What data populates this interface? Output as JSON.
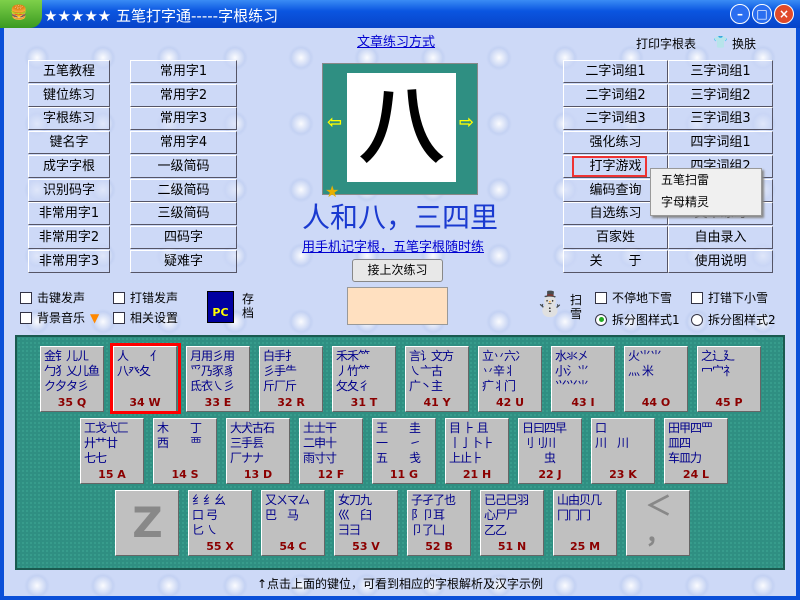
{
  "window": {
    "title": "★★★★★ 五笔打字通-----字根练习",
    "min": "–",
    "max": "□",
    "close": "×"
  },
  "top_link": "文章练习方式",
  "print_label": "打印字根表",
  "skin_label": "换肤",
  "left_buttons": [
    [
      "五笔教程",
      "常用字1"
    ],
    [
      "键位练习",
      "常用字2"
    ],
    [
      "字根练习",
      "常用字3"
    ],
    [
      "键名字",
      "常用字4"
    ],
    [
      "成字字根",
      "一级简码"
    ],
    [
      "识别码字",
      "二级简码"
    ],
    [
      "非常用字1",
      "三级简码"
    ],
    [
      "非常用字2",
      "四码字"
    ],
    [
      "非常用字3",
      "疑难字"
    ]
  ],
  "right_buttons": [
    [
      "二字词组1",
      "三字词组1"
    ],
    [
      "二字词组2",
      "三字词组2"
    ],
    [
      "二字词组3",
      "三字词组3"
    ],
    [
      "强化练习",
      "四字词组1"
    ],
    [
      "打字游戏",
      "四字词组2"
    ],
    [
      "编码查询",
      ""
    ],
    [
      "自选练习",
      "文章练习"
    ],
    [
      "百家姓",
      "自由录入"
    ],
    [
      "关　　于",
      "使用说明"
    ]
  ],
  "popup_menu": [
    "五笔扫雷",
    "字母精灵"
  ],
  "display": {
    "char": "八",
    "mnemonic": "人和八，三四里",
    "app_link": "用手机记字根，五笔字根随时练",
    "resume_button": "接上次练习"
  },
  "options": {
    "key_sound": "击键发声",
    "error_sound": "打错发声",
    "bg_music": "背景音乐",
    "settings": "相关设置",
    "save": "存档",
    "save_icon_text": "PC",
    "sweep_snow": "扫雪",
    "snow_nonstop": "不停地下雪",
    "snow_on_error": "打错下小雪",
    "style1": "拆分图样式1",
    "style2": "拆分图样式2"
  },
  "keys": [
    [
      {
        "roots": [
          "金钅儿ㄦ",
          "勹犭乂儿鱼",
          "ク夕タ彡"
        ],
        "code": "35 Q"
      },
      {
        "roots": [
          "人　　亻",
          "",
          "八癶夂"
        ],
        "code": "34 W"
      },
      {
        "roots": [
          "月用彡用",
          "爫乃豕豸",
          "氐衣㇏彡"
        ],
        "code": "33 E"
      },
      {
        "roots": [
          "白手扌",
          "彡手⺧",
          "斤厂斤"
        ],
        "code": "32 R"
      },
      {
        "roots": [
          "禾禾⺮",
          "丿竹⺮",
          "攵夂彳"
        ],
        "code": "31 T"
      },
      {
        "roots": [
          "言讠文方",
          "㇏亠古",
          "广丶主"
        ],
        "code": "41 Y"
      },
      {
        "roots": [
          "立丷六冫",
          "丷辛丬",
          "疒丬门"
        ],
        "code": "42 U"
      },
      {
        "roots": [
          "水氺㐅",
          "小氵⺌",
          "⺍⺍⺌"
        ],
        "code": "43 I"
      },
      {
        "roots": [
          "火⺌⺌",
          "",
          "灬 米"
        ],
        "code": "44 O"
      },
      {
        "roots": [
          "之辶廴",
          "",
          "冖宀礻"
        ],
        "code": "45 P"
      }
    ],
    [
      {
        "roots": [
          "工戈弋匚",
          "廾艹廿",
          "七七"
        ],
        "code": "15 A"
      },
      {
        "roots": [
          "木　　丁",
          "",
          "西　　覀"
        ],
        "code": "14 S"
      },
      {
        "roots": [
          "大犬古石",
          "三手镸",
          "厂ナナ"
        ],
        "code": "13 D"
      },
      {
        "roots": [
          "土士干",
          "二申十",
          "雨寸寸"
        ],
        "code": "12 F"
      },
      {
        "roots": [
          "王　　圭",
          "一　　㇀",
          "五　　戋"
        ],
        "code": "11 G"
      },
      {
        "roots": [
          "目 ⺊ 且",
          "丨亅卜⺊",
          "上止⺊"
        ],
        "code": "21 H"
      },
      {
        "roots": [
          "日曰四早",
          "刂刂川",
          "　　虫"
        ],
        "code": "22 J"
      },
      {
        "roots": [
          "口",
          "",
          "川　川"
        ],
        "code": "23 K"
      },
      {
        "roots": [
          "田甲四罒",
          "皿四",
          "车皿力"
        ],
        "code": "24 L"
      }
    ],
    [
      {
        "roots": [
          "Z"
        ],
        "code": ""
      },
      {
        "roots": [
          "纟纟幺",
          "口 弓",
          "匕 ㇏"
        ],
        "code": "55 X"
      },
      {
        "roots": [
          "又ㄨマ厶",
          "",
          "巴　马"
        ],
        "code": "54 C"
      },
      {
        "roots": [
          "女刀九",
          "巛　臼",
          "彐彐"
        ],
        "code": "53 V"
      },
      {
        "roots": [
          "子孑了也",
          "阝卩耳",
          "卩了凵"
        ],
        "code": "52 B"
      },
      {
        "roots": [
          "已己巳羽",
          "心尸尸",
          "乙乙"
        ],
        "code": "51 N"
      },
      {
        "roots": [
          "山由贝几",
          "冂冂冂"
        ],
        "code": "25 M"
      },
      {
        "roots": [
          "＜",
          "，"
        ],
        "code": ""
      }
    ]
  ],
  "hint": "↑点击上面的键位，可看到相应的字根解析及汉字示例"
}
